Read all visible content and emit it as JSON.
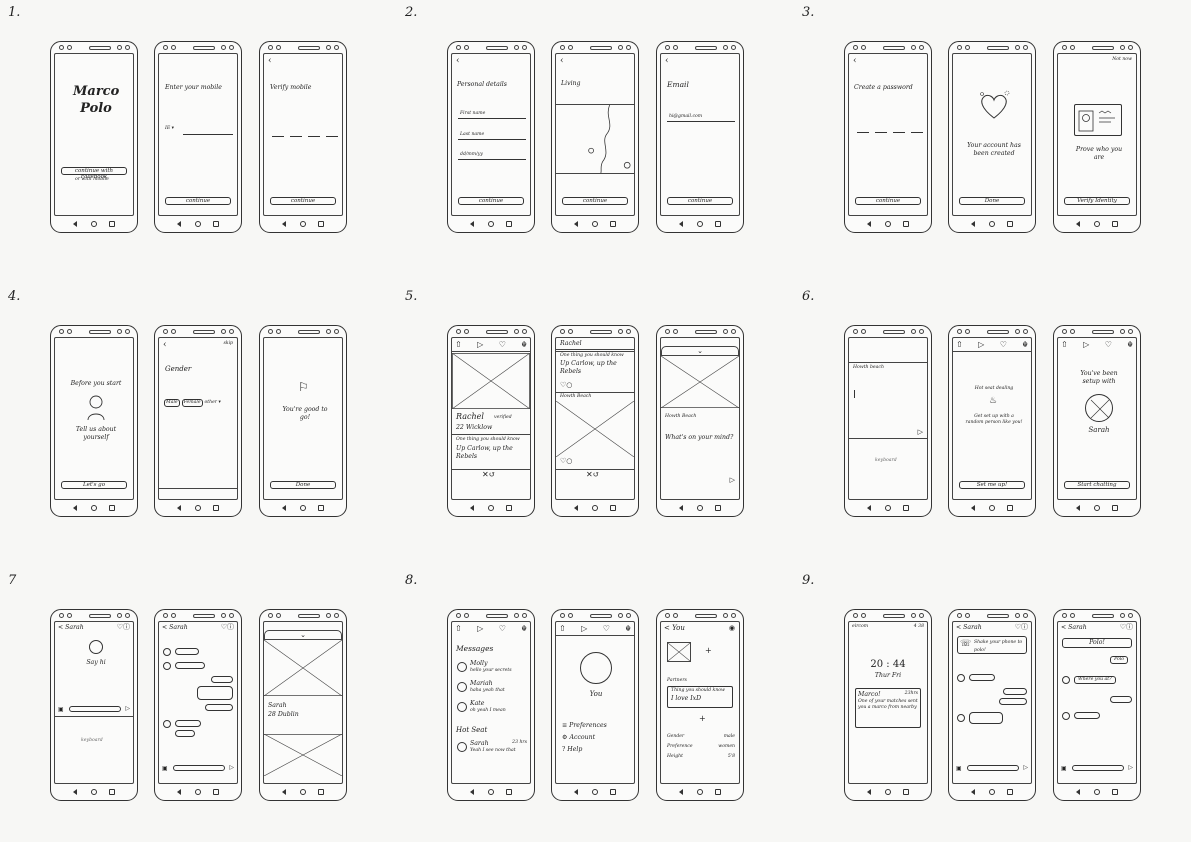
{
  "step_labels": [
    "1.",
    "2.",
    "3.",
    "4.",
    "5.",
    "6.",
    "7",
    "8.",
    "9."
  ],
  "s1": {
    "brand_line1": "Marco",
    "brand_line2": "Polo",
    "facebook_btn": "continue with Facebook",
    "mobile_link": "or with mobile",
    "enter_mobile": "Enter your mobile",
    "country_code": "IE ▾",
    "continue": "continue",
    "verify_title": "Verify mobile"
  },
  "s2": {
    "personal_title": "Personal details",
    "first_name": "First name",
    "last_name": "Last name",
    "dob": "dd/mm/yy",
    "continue": "continue",
    "living_title": "Living",
    "email_title": "Email",
    "email_value": "hi@gmail.com"
  },
  "s3": {
    "create_password": "Create a password",
    "continue": "continue",
    "created_text": "Your account has been created",
    "done": "Done",
    "not_now": "Not now",
    "prove_text": "Prove who you are",
    "verify_identity": "Verify Identity"
  },
  "s4": {
    "before_start": "Before you start",
    "tell_us": "Tell us about yourself",
    "lets_go": "Let's go",
    "skip": "skip",
    "gender_title": "Gender",
    "male": "Male",
    "female": "Female",
    "other": "other ▾",
    "good_to_go": "You're good to go!",
    "done": "Done"
  },
  "s5": {
    "profile_name": "Rachel",
    "verified": "verified",
    "age_place": "22 Wicklow",
    "prompt_q": "One thing you should know",
    "prompt_a": "Up Carlow, up the Rebels",
    "location": "Howth Beach",
    "whats_on_mind": "What's on your mind?"
  },
  "s6": {
    "location": "Howth beach",
    "keyboard": "keyboard",
    "hot_seat": "Hot seat dealing",
    "hot_seat_desc": "Get set up with a random person like you!",
    "set_me_up": "Set me up!",
    "setup_text": "You've been setup with",
    "match_name": "Sarah",
    "start_chatting": "Start chatting"
  },
  "s7": {
    "chat_name": "Sarah",
    "say_hi": "Say hi",
    "keyboard": "keyboard",
    "match_name": "Sarah",
    "match_info": "28 Dublin"
  },
  "s8": {
    "messages_title": "Messages",
    "msgs": [
      {
        "name": "Molly",
        "preview": "hello your secrets"
      },
      {
        "name": "Mariah",
        "preview": "haha yeah that"
      },
      {
        "name": "Kate",
        "preview": "oh yeah I mean"
      }
    ],
    "hot_seat": "Hot Seat",
    "hot_name": "Sarah",
    "hot_time": "23 hrs",
    "hot_preview": "Yeah I see now that",
    "you": "You",
    "menu": [
      "Preferences",
      "Account",
      "Help"
    ],
    "you_header": "You",
    "partners": "Partners",
    "prompt_q": "Thing you should know",
    "prompt_a": "I love IxD",
    "fields": [
      {
        "label": "Gender",
        "value": "male"
      },
      {
        "label": "Preference",
        "value": "women"
      },
      {
        "label": "Height",
        "value": "5'8"
      }
    ]
  },
  "s9": {
    "carrier": "eircom",
    "battery": "4 38",
    "time": "20 : 44",
    "date": "Thur Fri",
    "notif_title": "Marco!",
    "notif_time": "23hrs",
    "notif_body": "One of your matches sent you a marco from nearby",
    "chat_name": "Sarah",
    "shake_text": "Shake your phone to polo!",
    "polo": "Polo!",
    "polo_reply": "Polo",
    "where_text": "Where you at?"
  }
}
